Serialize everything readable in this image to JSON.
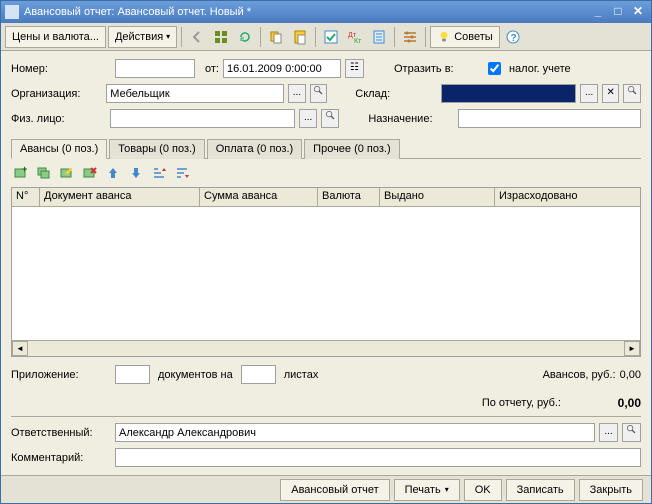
{
  "titlebar": {
    "title": "Авансовый отчет: Авансовый отчет. Новый *"
  },
  "menu": {
    "prices": "Цены и валюта...",
    "actions": "Действия",
    "advice": "Советы"
  },
  "form": {
    "number_label": "Номер:",
    "number_value": "",
    "from_label": "от:",
    "date_value": "16.01.2009 0:00:00",
    "reflect_label": "Отразить в:",
    "tax_label": "налог. учете",
    "org_label": "Организация:",
    "org_value": "Мебельщик",
    "warehouse_label": "Склад:",
    "warehouse_value": "",
    "person_label": "Физ. лицо:",
    "person_value": "",
    "purpose_label": "Назначение:",
    "purpose_value": "",
    "attach_label": "Приложение:",
    "attach_docs": "документов на",
    "attach_sheets": "листах",
    "advance_label": "Авансов, руб.:",
    "advance_value": "0,00",
    "report_label": "По отчету, руб.:",
    "report_value": "0,00",
    "responsible_label": "Ответственный:",
    "responsible_value": "Александр Александрович",
    "comment_label": "Комментарий:",
    "comment_value": ""
  },
  "tabs": [
    {
      "label": "Авансы (0 поз.)"
    },
    {
      "label": "Товары (0 поз.)"
    },
    {
      "label": "Оплата (0 поз.)"
    },
    {
      "label": "Прочее (0 поз.)"
    }
  ],
  "grid": {
    "cols": [
      "N°",
      "Документ аванса",
      "Сумма аванса",
      "Валюта",
      "Выдано",
      "Израсходовано"
    ]
  },
  "footer": {
    "report": "Авансовый отчет",
    "print": "Печать",
    "ok": "OK",
    "write": "Записать",
    "close": "Закрыть"
  }
}
